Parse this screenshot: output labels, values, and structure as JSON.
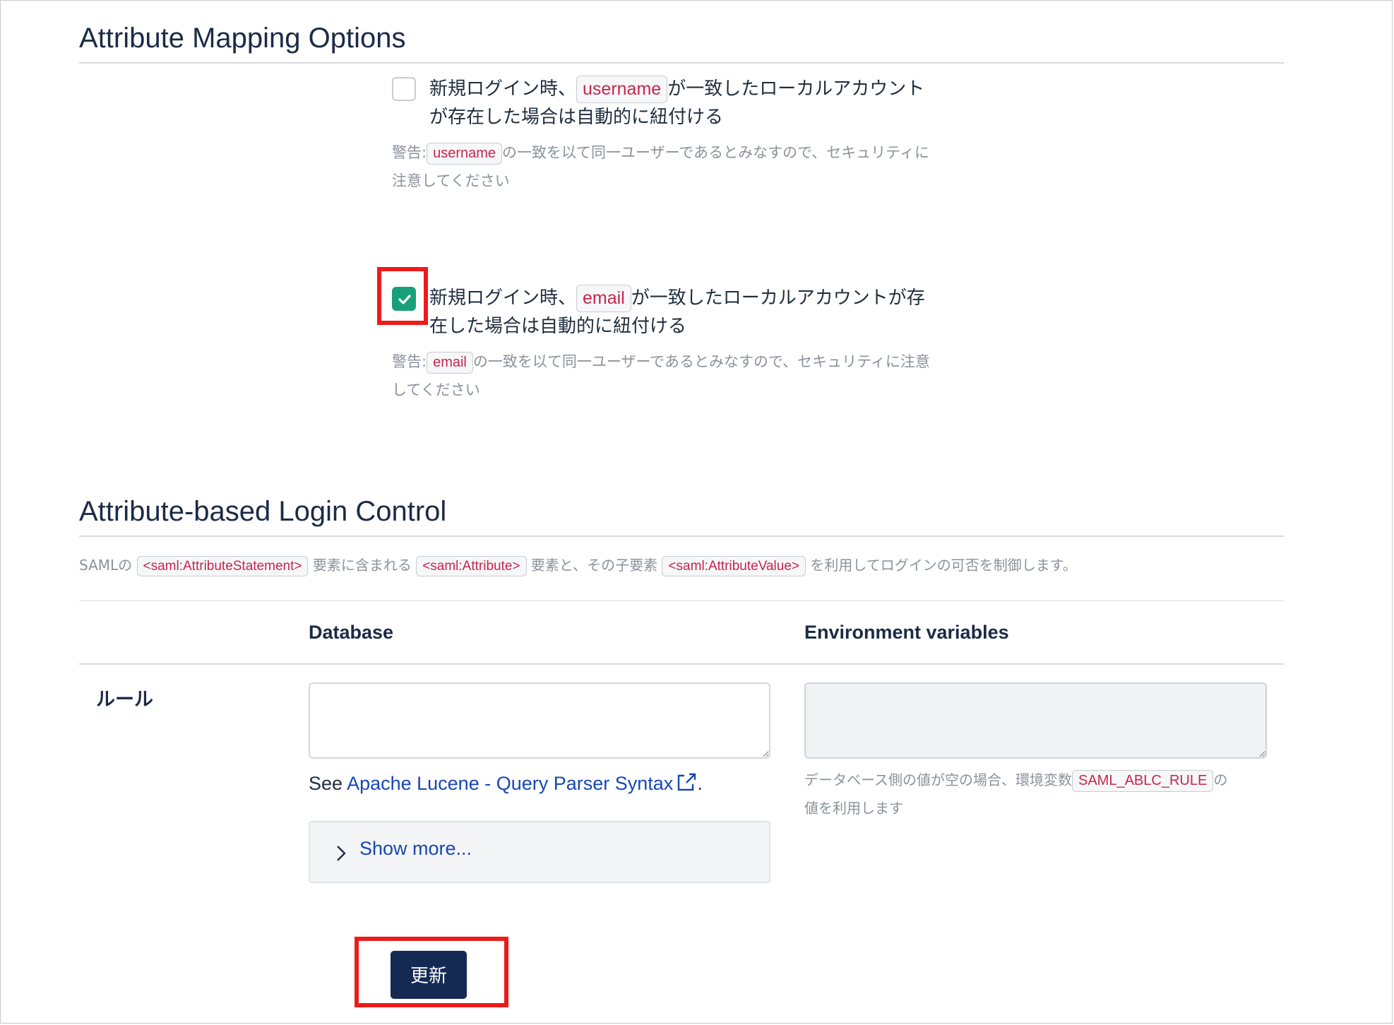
{
  "mapping": {
    "title": "Attribute Mapping Options",
    "username_option": {
      "checked": false,
      "label_pre": "新規ログイン時、",
      "code": "username",
      "label_post_line1": "が一致したローカルアカウント",
      "label_line2": "が存在した場合は自動的に紐付ける",
      "warning_prefix": "警告:",
      "warning_code": "username",
      "warning_line1": "の一致を以て同一ユーザーであるとみなすので、セキュリティに",
      "warning_line2": "注意してください"
    },
    "email_option": {
      "checked": true,
      "label_pre": "新規ログイン時、",
      "code": "email",
      "label_post_line1": "が一致したローカルアカウントが存",
      "label_line2": "在した場合は自動的に紐付ける",
      "warning_prefix": "警告:",
      "warning_code": "email",
      "warning_line1": "の一致を以て同一ユーザーであるとみなすので、セキュリティに注意",
      "warning_line2": "してください"
    }
  },
  "login_control": {
    "title": "Attribute-based Login Control",
    "desc_1": "SAMLの",
    "desc_code_1": "<saml:AttributeStatement>",
    "desc_2": "要素に含まれる",
    "desc_code_2": "<saml:Attribute>",
    "desc_3": "要素と、その子要素",
    "desc_code_3": "<saml:AttributeValue>",
    "desc_4": "を利用してログインの可否を制御します。",
    "col_database": "Database",
    "col_env": "Environment variables",
    "row_label": "ルール",
    "rule_db_value": "",
    "rule_env_value": "",
    "see_prefix": "See ",
    "see_link": "Apache Lucene - Query Parser Syntax",
    "see_suffix": ".",
    "show_more": "Show more...",
    "env_help_1": "データベース側の値が空の場合、環境変数",
    "env_help_code": "SAML_ABLC_RULE",
    "env_help_2": "の",
    "env_help_3": "値を利用します",
    "submit": "更新"
  },
  "colors": {
    "accent": "#1aa079",
    "link": "#1747b3",
    "button": "#142a52",
    "highlight": "#ee1b1b",
    "code_text": "#c7254e"
  },
  "icons": {
    "check": "check-icon",
    "external": "external-link-icon",
    "chevron": "chevron-right-icon"
  }
}
